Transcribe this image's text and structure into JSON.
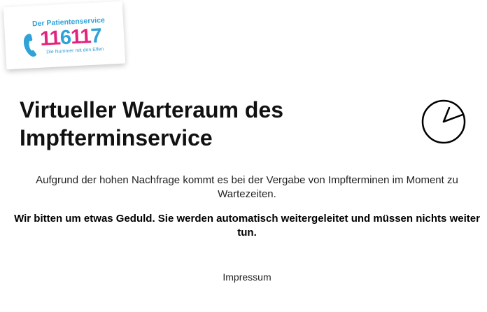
{
  "logo": {
    "tagline_top": "Der Patientenservice",
    "number_parts": [
      "11",
      "6",
      "11",
      "7"
    ],
    "tagline_bottom": "Die Nummer mit den Elfen",
    "icon": "phone-icon",
    "colors": {
      "blue": "#2fa3d7",
      "pink": "#e2237d"
    }
  },
  "main": {
    "title": "Virtueller Warteraum des Impfterminservice",
    "clock_icon": "clock-icon",
    "intro_text": "Aufgrund der hohen Nachfrage kommt es bei der Vergabe von Impfterminen im Moment zu Wartezeiten.",
    "notice_text": "Wir bitten um etwas Geduld. Sie werden automatisch weitergeleitet und müssen nichts weiter tun."
  },
  "footer": {
    "impressum_label": "Impressum"
  }
}
